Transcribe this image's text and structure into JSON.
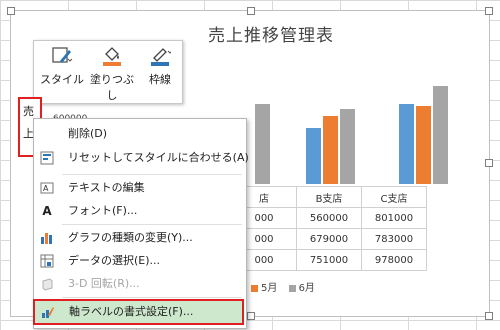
{
  "chart": {
    "title": "売上推移管理表",
    "axis_value_label": "600000",
    "axis_box_labels": [
      "売",
      "上"
    ],
    "table_rows": [
      [
        "店",
        "B支店",
        "C支店"
      ],
      [
        "000",
        "560000",
        "801000"
      ],
      [
        "000",
        "679000",
        "783000"
      ],
      [
        "000",
        "751000",
        "978000"
      ]
    ],
    "legend": [
      {
        "label": "5月",
        "color": "#ed7d31"
      },
      {
        "label": "6月",
        "color": "#a5a5a5"
      }
    ]
  },
  "chart_data": {
    "type": "bar",
    "title": "売上推移管理表",
    "categories": [
      "A支店",
      "B支店",
      "C支店"
    ],
    "series": [
      {
        "values": [
          null,
          560000,
          801000
        ],
        "color": "#5b9bd5"
      },
      {
        "name": "5月",
        "values": [
          null,
          679000,
          783000
        ],
        "color": "#ed7d31"
      },
      {
        "name": "6月",
        "values": [
          null,
          751000,
          978000
        ],
        "color": "#a5a5a5"
      }
    ]
  },
  "toolbar": {
    "style_label": "スタイル",
    "fill_label": "塗りつぶし",
    "outline_label": "枠線"
  },
  "menu": {
    "delete": "削除(D)",
    "reset": "リセットしてスタイルに合わせる(A)",
    "edit_text": "テキストの編集",
    "font": "フォント(F)...",
    "change_type": "グラフの種類の変更(Y)...",
    "select_data": "データの選択(E)...",
    "rotate_3d": "3-D 回転(R)...",
    "format_axis_title": "軸ラベルの書式設定(F)..."
  },
  "colors": {
    "accent_red": "#e02020",
    "highlight": "#cde8cd"
  }
}
